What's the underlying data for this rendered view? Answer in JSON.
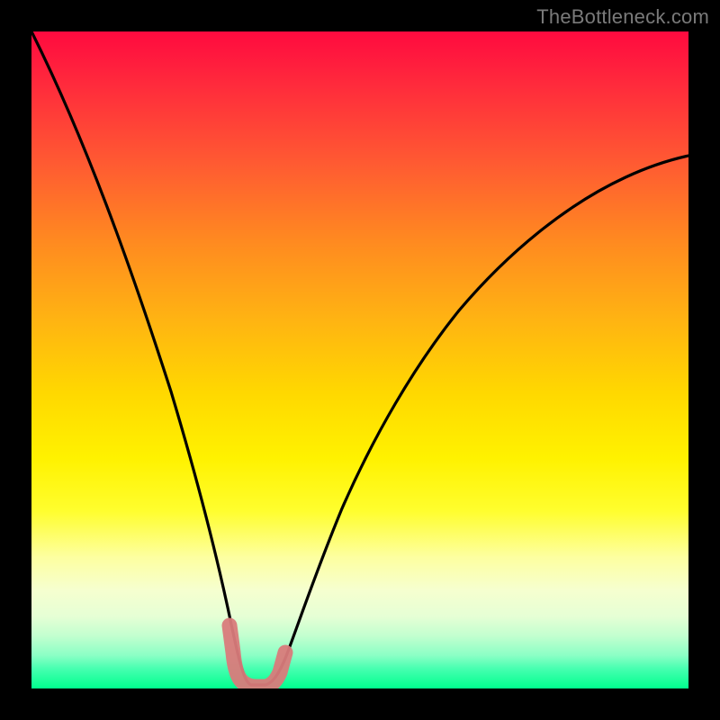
{
  "watermark": {
    "text": "TheBottleneck.com"
  },
  "chart_data": {
    "type": "line",
    "title": "",
    "xlabel": "",
    "ylabel": "",
    "xlim": [
      0,
      100
    ],
    "ylim": [
      0,
      100
    ],
    "grid": false,
    "series": [
      {
        "name": "bottleneck-curve",
        "color": "#000000",
        "x": [
          0,
          5,
          10,
          15,
          20,
          25,
          28,
          30,
          32,
          34,
          36,
          38,
          40,
          45,
          50,
          55,
          60,
          65,
          70,
          75,
          80,
          85,
          90,
          95,
          100
        ],
        "values": [
          100,
          83,
          67,
          50,
          33,
          15,
          5,
          1,
          0,
          0,
          0,
          1,
          3,
          12,
          22,
          32,
          41,
          49,
          56,
          62,
          67,
          71,
          75,
          78,
          80
        ]
      }
    ],
    "markers": [
      {
        "name": "optimal-range-marker",
        "color": "#d97b7b",
        "x": [
          28,
          30,
          32,
          34,
          36
        ],
        "values": [
          5,
          1,
          0,
          0,
          3
        ]
      }
    ]
  }
}
